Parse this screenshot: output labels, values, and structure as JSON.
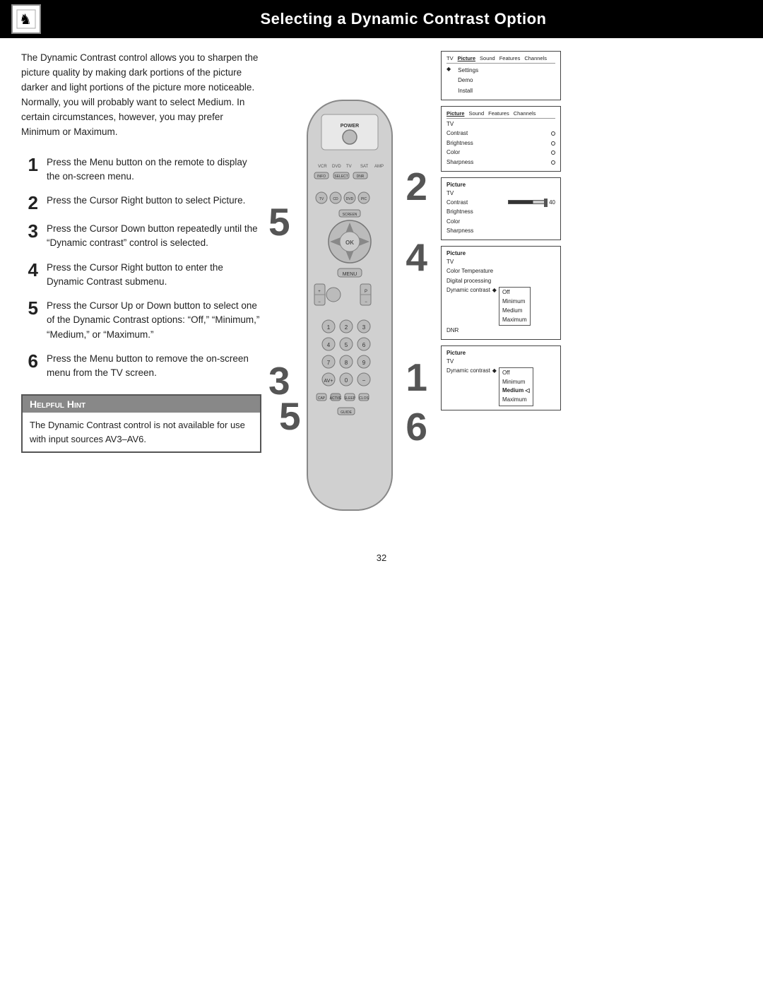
{
  "header": {
    "title": "Selecting a Dynamic Contrast Option"
  },
  "intro": "The Dynamic Contrast control allows you to sharpen the picture quality by making dark portions of the picture darker and light portions of the picture more noticeable. Normally, you will probably want to select Medium. In certain circumstances, however, you may prefer Minimum or Maximum.",
  "steps": [
    {
      "number": "1",
      "text": "Press the Menu button on the remote to display the on-screen menu."
    },
    {
      "number": "2",
      "text": "Press the Cursor Right button to select Picture."
    },
    {
      "number": "3",
      "text": "Press the Cursor Down button repeatedly until the “Dynamic contrast” control is selected."
    },
    {
      "number": "4",
      "text": "Press the Cursor Right button to enter the Dynamic Contrast submenu."
    },
    {
      "number": "5",
      "text": "Press the Cursor Up or Down button to select one of the Dynamic Contrast options: “Off,” “Minimum,” “Medium,” or “Maximum.”"
    },
    {
      "number": "6",
      "text": "Press the Menu button to remove the on-screen menu from the TV screen."
    }
  ],
  "helpful_hint": {
    "title": "Helpful Hint",
    "body": "The Dynamic Contrast control is not available for use with input sources AV3–AV6."
  },
  "diagrams": {
    "diag1": {
      "menu_items": [
        "Picture",
        "Sound",
        "Features",
        "Channels"
      ],
      "tv_label": "TV",
      "left_items": [
        "Settings",
        "Demo",
        "Install"
      ]
    },
    "diag2": {
      "menu_items": [
        "Picture",
        "Sound",
        "Features",
        "Channels"
      ],
      "tv_label": "TV",
      "rows": [
        "Contrast",
        "Brightness",
        "Color",
        "Sharpness"
      ]
    },
    "diag3": {
      "tv_label": "TV",
      "rows": [
        "Contrast",
        "Brightness",
        "Color",
        "Sharpness"
      ],
      "slider_label": "Contrast",
      "slider_value": "40"
    },
    "diag4": {
      "tv_label": "TV",
      "rows": [
        "Color Temperature",
        "Digital processing",
        "Dynamic contrast",
        "DNR"
      ],
      "options": [
        "Off",
        "Minimum",
        "Medium",
        "Maximum"
      ]
    },
    "diag5": {
      "tv_label": "TV",
      "rows": [
        "Dynamic contrast"
      ],
      "options": [
        "Off",
        "Minimum",
        "Medium",
        "Maximum"
      ],
      "selected": "Medium"
    }
  },
  "callouts": [
    "5",
    "2",
    "4",
    "3",
    "5",
    "1",
    "6"
  ],
  "page_number": "32"
}
